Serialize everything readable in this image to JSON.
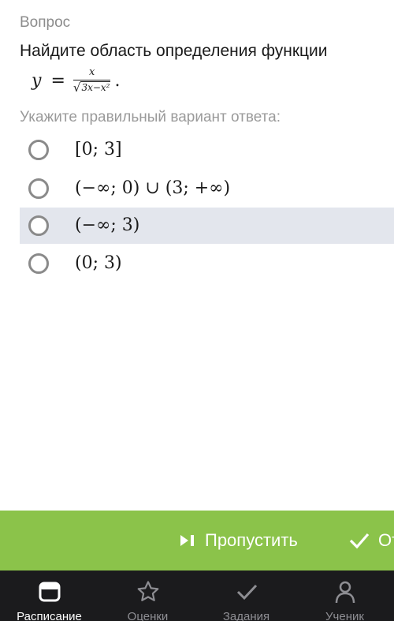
{
  "question": {
    "label": "Вопрос",
    "text": "Найдите область определения функции",
    "formula": {
      "lhs": "y",
      "eq": "=",
      "numerator": "x",
      "radicand": "3x−x²",
      "end": "."
    },
    "hint": "Укажите правильный вариант ответа:"
  },
  "options": [
    {
      "label": "[0; 3]"
    },
    {
      "label": "(−∞; 0) ∪ (3; +∞)"
    },
    {
      "label": "(−∞; 3)"
    },
    {
      "label": "(0; 3)"
    }
  ],
  "actions": {
    "skip_label": "Пропустить",
    "skip_icon": "skip-next-icon",
    "answer_label": "Ответить",
    "answer_icon": "check-icon",
    "color": "#8bc34a"
  },
  "nav": {
    "items": [
      {
        "label": "Расписание",
        "icon": "calendar-icon",
        "active": true
      },
      {
        "label": "Оценки",
        "icon": "star-icon",
        "active": false
      },
      {
        "label": "Задания",
        "icon": "check-icon",
        "active": false
      },
      {
        "label": "Ученик",
        "icon": "person-icon",
        "active": false
      }
    ],
    "background": "#1b1b1d"
  }
}
